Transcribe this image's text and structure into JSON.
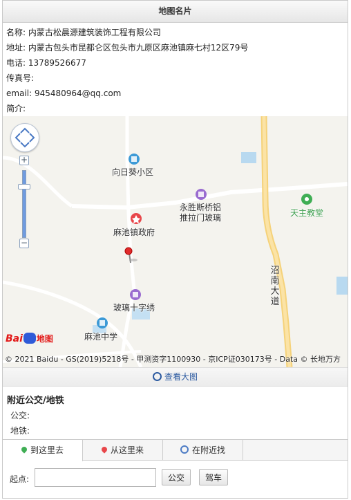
{
  "card": {
    "title": "地图名片",
    "fields": [
      {
        "label": "名称:",
        "value": "内蒙古松晨源建筑装饰工程有限公司"
      },
      {
        "label": "地址:",
        "value": "内蒙古包头市昆都仑区包头市九原区麻池镇麻七村12区79号"
      },
      {
        "label": "电话:",
        "value": "13789526677"
      },
      {
        "label": "传真号:",
        "value": ""
      },
      {
        "label": "email:",
        "value": "945480964@qq.com"
      },
      {
        "label": "简介:",
        "value": ""
      }
    ]
  },
  "map": {
    "pois": {
      "xiangrikui": "向日葵小区",
      "yongsheng_line1": "永胜断桥铝",
      "yongsheng_line2": "推拉门玻璃",
      "tianzhu": "天主教堂",
      "machi_gov": "麻池镇政府",
      "boli": "玻璃十字绣",
      "machi_school": "麻池中学"
    },
    "road_label": "沼南大道",
    "logo_text": "地图",
    "logo_brand": "Bai",
    "copyright": "© 2021 Baidu - GS(2019)5218号 - 甲测资字1100930 - 京ICP证030173号 - Data © 长地万方",
    "zoom_in": "+",
    "zoom_out": "−"
  },
  "view_large": "查看大图",
  "transit": {
    "title": "附近公交/地铁",
    "bus_label": "公交:",
    "subway_label": "地铁:"
  },
  "tabs": [
    {
      "label": "到这里去",
      "icon": "green-pin-icon"
    },
    {
      "label": "从这里来",
      "icon": "red-pin-icon"
    },
    {
      "label": "在附近找",
      "icon": "search-icon"
    }
  ],
  "route": {
    "start_label": "起点:",
    "start_value": "",
    "start_placeholder": "",
    "bus_button": "公交",
    "drive_button": "驾车"
  },
  "colors": {
    "road_major": "#f7d88a",
    "road_minor": "#ffffff",
    "water": "#aad3ee",
    "poi_blue": "#3d9ad6",
    "poi_purple": "#9a6cd0",
    "poi_green": "#3fae54",
    "poi_red": "#e8464a",
    "link": "#2c5aa0"
  }
}
